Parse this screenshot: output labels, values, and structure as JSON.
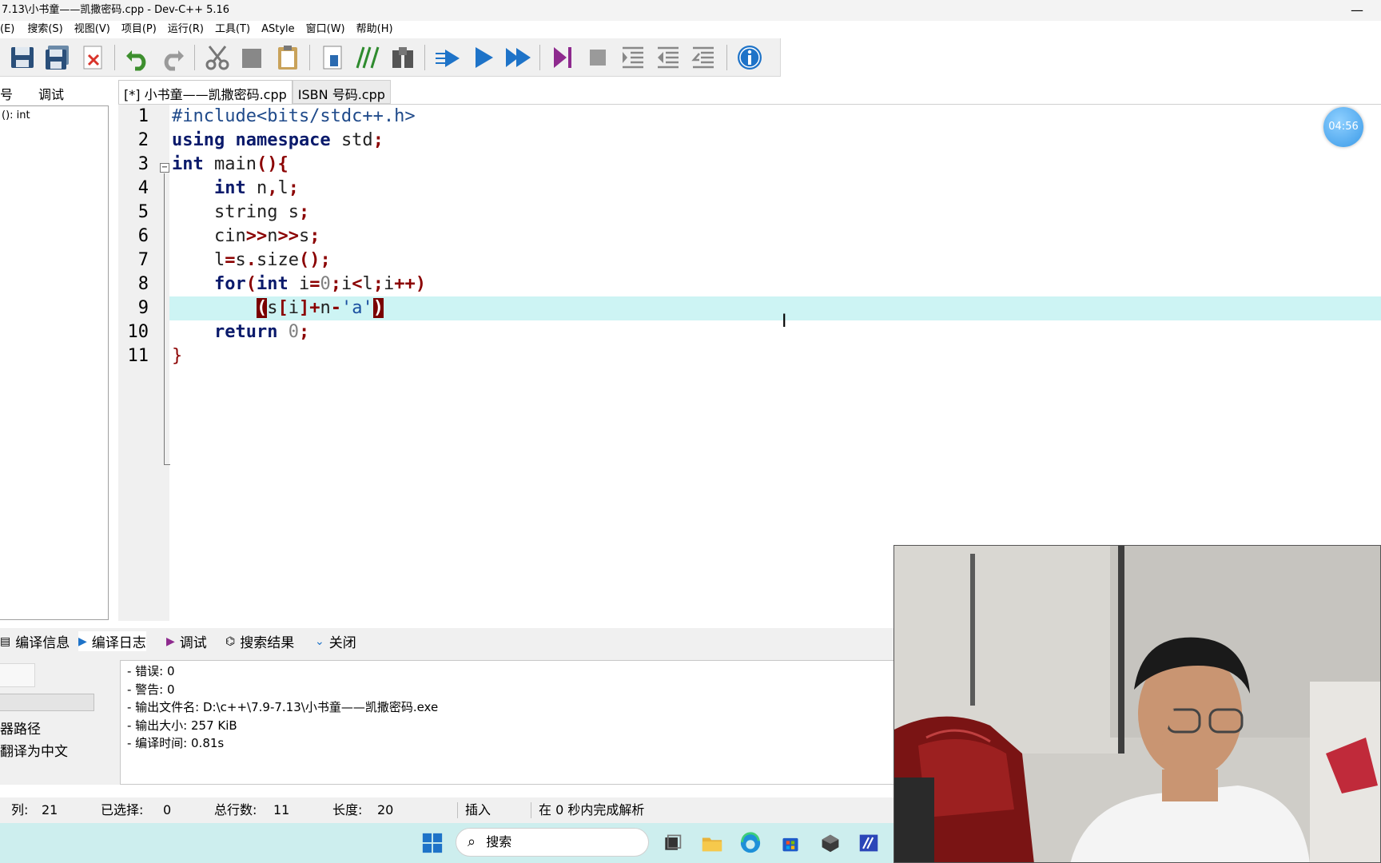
{
  "window": {
    "title": "7.13\\小书童——凯撒密码.cpp - Dev-C++ 5.16",
    "minimize_glyph": "—"
  },
  "menu": [
    "(E)",
    "搜索(S)",
    "视图(V)",
    "项目(P)",
    "运行(R)",
    "工具(T)",
    "AStyle",
    "窗口(W)",
    "帮助(H)"
  ],
  "toolbar": {
    "icons": [
      "save-all-icon",
      "save-icon",
      "close-file-icon",
      "undo-icon",
      "redo-icon",
      "cut-icon",
      "copy-icon",
      "paste-icon",
      "new-file-icon",
      "comment-icon",
      "find-icon",
      "compile-icon",
      "run-icon",
      "compile-run-icon",
      "debug-icon",
      "stop-icon",
      "indent-icon",
      "unindent-icon",
      "toggle-comment-icon",
      "info-icon"
    ]
  },
  "left_panel": {
    "tab_symbols": "号",
    "tab_debug": "调试",
    "item": "(): int"
  },
  "editor": {
    "tabs": [
      {
        "label": "[*] 小书童——凯撒密码.cpp",
        "active": true
      },
      {
        "label": "ISBN 号码.cpp",
        "active": false
      }
    ],
    "current_line": 9,
    "lines": [
      {
        "n": "1",
        "text": "#include<bits/stdc++.h>"
      },
      {
        "n": "2",
        "text": "using namespace std;"
      },
      {
        "n": "3",
        "text": "int main(){"
      },
      {
        "n": "4",
        "text": "    int n,l;"
      },
      {
        "n": "5",
        "text": "    string s;"
      },
      {
        "n": "6",
        "text": "    cin>>n>>s;"
      },
      {
        "n": "7",
        "text": "    l=s.size();"
      },
      {
        "n": "8",
        "text": "    for(int i=0;i<l;i++)"
      },
      {
        "n": "9",
        "text": "        (s[i]+n-'a')"
      },
      {
        "n": "10",
        "text": "    return 0;"
      },
      {
        "n": "11",
        "text": "}"
      }
    ],
    "fold_marker": "⊟"
  },
  "timer": "04:56",
  "bottom": {
    "tabs": [
      "编译信息",
      "编译日志",
      "调试",
      "搜索结果",
      "关闭"
    ],
    "log": [
      "- 错误: 0",
      "- 警告: 0",
      "- 输出文件名: D:\\c++\\7.9-7.13\\小书童——凯撒密码.exe",
      "- 输出大小: 257 KiB",
      "- 编译时间: 0.81s"
    ],
    "left_text1": "器路径",
    "left_text2": "翻译为中文"
  },
  "status": {
    "col_label": "列:",
    "col_value": "21",
    "selected_label": "已选择:",
    "selected_value": "0",
    "lines_label": "总行数:",
    "lines_value": "11",
    "length_label": "长度:",
    "length_value": "20",
    "mode": "插入",
    "parse": "在 0 秒内完成解析"
  },
  "taskbar": {
    "search_placeholder": "搜索"
  },
  "colors": {
    "current_line": "#cdf4f4",
    "keyword": "#0a1a6b",
    "symbol": "#8b0000",
    "taskbar": "#cdeeee"
  }
}
